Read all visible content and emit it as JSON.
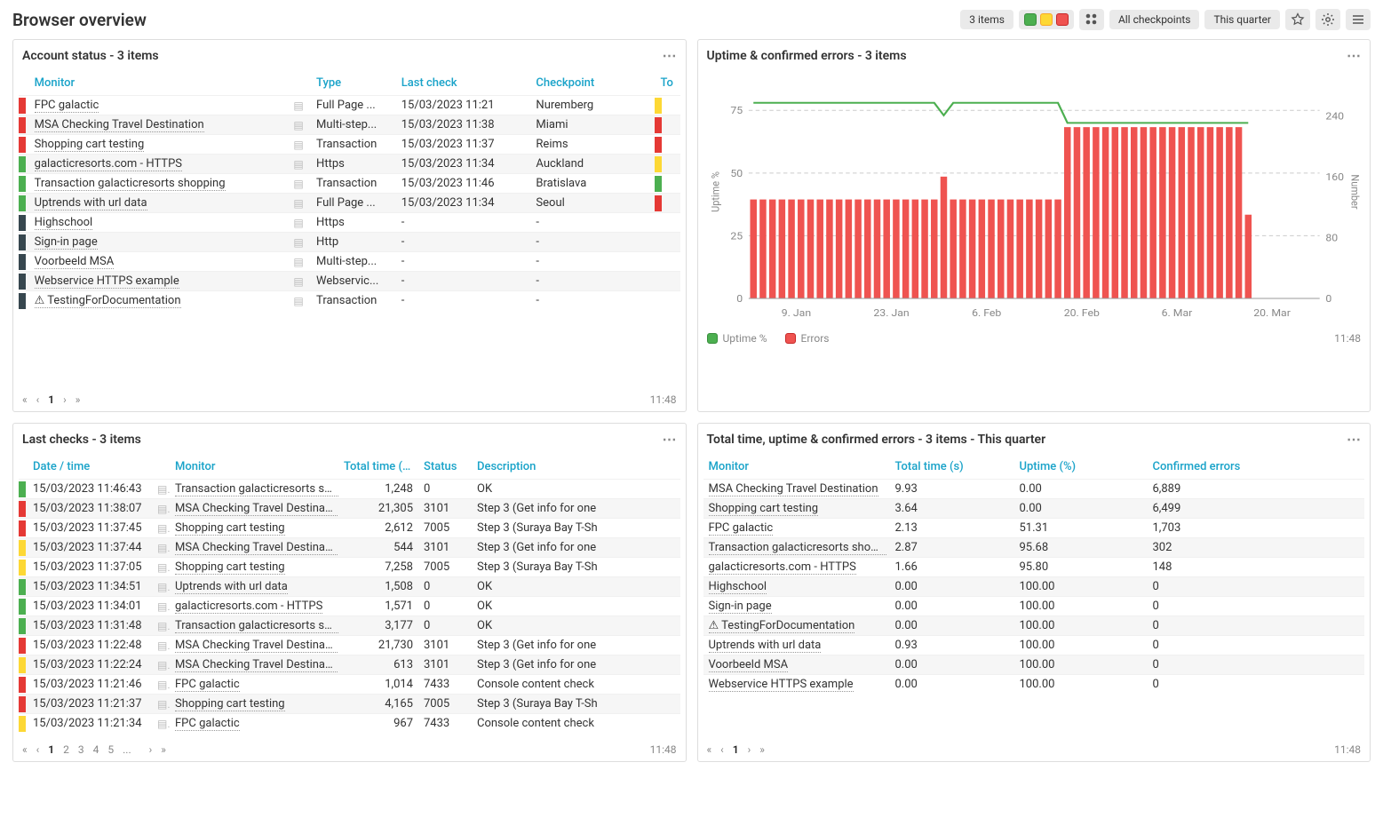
{
  "page_title": "Browser overview",
  "header": {
    "items_badge": "3 items",
    "checkpoints": "All checkpoints",
    "period": "This quarter"
  },
  "account_status": {
    "title": "Account status - 3 items",
    "columns": [
      "Monitor",
      "Type",
      "Last check",
      "Checkpoint",
      "To"
    ],
    "rows": [
      {
        "st": "red",
        "name": "FPC galactic",
        "type": "Full Page ...",
        "last": "15/03/2023 11:21",
        "cp": "Nuremberg",
        "tail": "yellow"
      },
      {
        "st": "red",
        "name": "MSA Checking Travel Destination",
        "type": "Multi-step...",
        "last": "15/03/2023 11:38",
        "cp": "Miami",
        "tail": "red"
      },
      {
        "st": "red",
        "name": "Shopping cart testing",
        "type": "Transaction",
        "last": "15/03/2023 11:37",
        "cp": "Reims",
        "tail": "red"
      },
      {
        "st": "green",
        "name": "galacticresorts.com - HTTPS",
        "type": "Https",
        "last": "15/03/2023 11:34",
        "cp": "Auckland",
        "tail": "yellow"
      },
      {
        "st": "green",
        "name": "Transaction galacticresorts shopping",
        "type": "Transaction",
        "last": "15/03/2023 11:46",
        "cp": "Bratislava",
        "tail": "green"
      },
      {
        "st": "green",
        "name": "Uptrends with url data",
        "type": "Full Page ...",
        "last": "15/03/2023 11:34",
        "cp": "Seoul",
        "tail": "red"
      },
      {
        "st": "dark",
        "name": "Highschool",
        "type": "Https",
        "last": "-",
        "cp": "-",
        "tail": ""
      },
      {
        "st": "dark",
        "name": "Sign-in page",
        "type": "Http",
        "last": "-",
        "cp": "-",
        "tail": ""
      },
      {
        "st": "dark",
        "name": "Voorbeeld MSA",
        "type": "Multi-step...",
        "last": "-",
        "cp": "-",
        "tail": ""
      },
      {
        "st": "dark",
        "name": "Webservice HTTPS example",
        "type": "Webservic...",
        "last": "-",
        "cp": "-",
        "tail": ""
      },
      {
        "st": "dark",
        "name": "TestingForDocumentation",
        "type": "Transaction",
        "last": "-",
        "cp": "-",
        "tail": "",
        "warn": true
      }
    ],
    "pager_time": "11:48",
    "page": "1"
  },
  "last_checks": {
    "title": "Last checks - 3 items",
    "columns": [
      "Date / time",
      "Monitor",
      "Total time (ms)",
      "Status",
      "Description"
    ],
    "rows": [
      {
        "st": "green",
        "dt": "15/03/2023 11:46:43",
        "mon": "Transaction galacticresorts shop...",
        "tt": "1,248",
        "status": "0",
        "desc": "OK"
      },
      {
        "st": "red",
        "dt": "15/03/2023 11:38:07",
        "mon": "MSA Checking Travel Destination",
        "tt": "21,305",
        "status": "3101",
        "desc": "Step 3 (Get info for one"
      },
      {
        "st": "red",
        "dt": "15/03/2023 11:37:45",
        "mon": "Shopping cart testing",
        "tt": "2,612",
        "status": "7005",
        "desc": "Step 3 (Suraya Bay T-Sh"
      },
      {
        "st": "yellow",
        "dt": "15/03/2023 11:37:44",
        "mon": "MSA Checking Travel Destination",
        "tt": "544",
        "status": "3101",
        "desc": "Step 3 (Get info for one"
      },
      {
        "st": "yellow",
        "dt": "15/03/2023 11:37:05",
        "mon": "Shopping cart testing",
        "tt": "7,258",
        "status": "7005",
        "desc": "Step 3 (Suraya Bay T-Sh"
      },
      {
        "st": "green",
        "dt": "15/03/2023 11:34:51",
        "mon": "Uptrends with url data",
        "tt": "1,508",
        "status": "0",
        "desc": "OK"
      },
      {
        "st": "green",
        "dt": "15/03/2023 11:34:01",
        "mon": "galacticresorts.com - HTTPS",
        "tt": "1,571",
        "status": "0",
        "desc": "OK"
      },
      {
        "st": "green",
        "dt": "15/03/2023 11:31:48",
        "mon": "Transaction galacticresorts shop...",
        "tt": "3,177",
        "status": "0",
        "desc": "OK"
      },
      {
        "st": "red",
        "dt": "15/03/2023 11:22:48",
        "mon": "MSA Checking Travel Destination",
        "tt": "21,730",
        "status": "3101",
        "desc": "Step 3 (Get info for one"
      },
      {
        "st": "yellow",
        "dt": "15/03/2023 11:22:24",
        "mon": "MSA Checking Travel Destination",
        "tt": "613",
        "status": "3101",
        "desc": "Step 3 (Get info for one"
      },
      {
        "st": "red",
        "dt": "15/03/2023 11:21:46",
        "mon": "FPC galactic",
        "tt": "1,014",
        "status": "7433",
        "desc": "Console content check"
      },
      {
        "st": "red",
        "dt": "15/03/2023 11:21:37",
        "mon": "Shopping cart testing",
        "tt": "4,165",
        "status": "7005",
        "desc": "Step 3 (Suraya Bay T-Sh"
      },
      {
        "st": "yellow",
        "dt": "15/03/2023 11:21:34",
        "mon": "FPC galactic",
        "tt": "967",
        "status": "7433",
        "desc": "Console content check"
      }
    ],
    "pages": [
      "1",
      "2",
      "3",
      "4",
      "5",
      "..."
    ],
    "pager_time": "11:48"
  },
  "uptime_chart": {
    "title": "Uptime & confirmed errors - 3 items",
    "legend_uptime": "Uptime %",
    "legend_errors": "Errors",
    "y_left_label": "Uptime %",
    "y_right_label": "Number",
    "pager_time": "11:48"
  },
  "chart_data": {
    "type": "bar+line",
    "x_ticks": [
      "9. Jan",
      "23. Jan",
      "6. Feb",
      "20. Feb",
      "6. Mar",
      "20. Mar"
    ],
    "y_left": {
      "label": "Uptime %",
      "ticks": [
        0,
        25,
        50,
        75
      ],
      "range": [
        0,
        85
      ]
    },
    "y_right": {
      "label": "Number",
      "ticks": [
        0,
        80,
        160,
        240
      ],
      "range": [
        0,
        280
      ]
    },
    "n_bars": 60,
    "series": [
      {
        "name": "Uptime %",
        "type": "line",
        "axis": "left",
        "color": "#4caf50",
        "approx": "~78 from bar 1→33, dips to ~73 at bar 21, then drops to ~70 from bar 34 onward; no data after bar 53"
      },
      {
        "name": "Errors",
        "type": "bar",
        "axis": "right",
        "color": "#ef5350",
        "approx": "~130 for bars 1–33 (one spike ~160 at bar 21), ~225 for bars 34–52, bar 53 ~110; bars 54–60 empty"
      }
    ]
  },
  "totals": {
    "title": "Total time, uptime & confirmed errors - 3 items - This quarter",
    "columns": [
      "Monitor",
      "Total time (s)",
      "Uptime (%)",
      "Confirmed errors"
    ],
    "rows": [
      {
        "mon": "MSA Checking Travel Destination",
        "tt": "9.93",
        "up": "0.00",
        "err": "6,889"
      },
      {
        "mon": "Shopping cart testing",
        "tt": "3.64",
        "up": "0.00",
        "err": "6,499"
      },
      {
        "mon": "FPC galactic",
        "tt": "2.13",
        "up": "51.31",
        "err": "1,703"
      },
      {
        "mon": "Transaction galacticresorts shop...",
        "tt": "2.87",
        "up": "95.68",
        "err": "302"
      },
      {
        "mon": "galacticresorts.com - HTTPS",
        "tt": "1.66",
        "up": "95.80",
        "err": "148"
      },
      {
        "mon": "Highschool",
        "tt": "0.00",
        "up": "100.00",
        "err": "0"
      },
      {
        "mon": "Sign-in page",
        "tt": "0.00",
        "up": "100.00",
        "err": "0"
      },
      {
        "mon": "TestingForDocumentation",
        "tt": "0.00",
        "up": "100.00",
        "err": "0",
        "warn": true
      },
      {
        "mon": "Uptrends with url data",
        "tt": "0.93",
        "up": "100.00",
        "err": "0"
      },
      {
        "mon": "Voorbeeld MSA",
        "tt": "0.00",
        "up": "100.00",
        "err": "0"
      },
      {
        "mon": "Webservice HTTPS example",
        "tt": "0.00",
        "up": "100.00",
        "err": "0"
      }
    ],
    "page": "1",
    "pager_time": "11:48"
  }
}
